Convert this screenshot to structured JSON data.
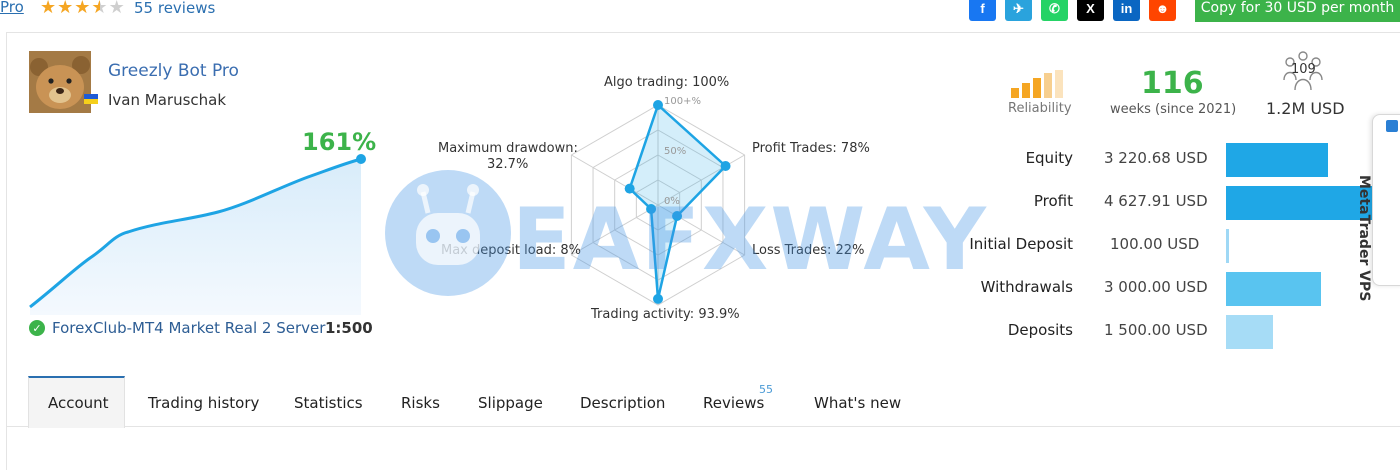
{
  "header": {
    "product_link": "Pro",
    "rating": 3.5,
    "reviews_label": "55 reviews",
    "share_icons": [
      "facebook-icon",
      "telegram-icon",
      "whatsapp-icon",
      "x-icon",
      "linkedin-icon",
      "reddit-icon"
    ],
    "share_glyphs": [
      "f",
      "✈",
      "✆",
      "X",
      "in",
      "☻"
    ],
    "share_colors": [
      "#1877f2",
      "#2aa3dd",
      "#25d366",
      "#000000",
      "#0a66c2",
      "#ff4500"
    ],
    "copy_button": "Copy for 30 USD per month"
  },
  "signal": {
    "name": "Greezly Bot Pro",
    "author": "Ivan Maruschak",
    "growth": "161%",
    "server": "ForexClub-MT4 Market Real 2 Server",
    "leverage": "1:500"
  },
  "radar": {
    "labels": {
      "algo": "Algo trading: 100%",
      "profit": "Profit Trades: 78%",
      "loss": "Loss Trades: 22%",
      "activity": "Trading activity: 93.9%",
      "deposit": "Max deposit load: 8%",
      "drawdown_title": "Maximum drawdown:",
      "drawdown_value": "32.7%"
    },
    "scale": [
      "100+%",
      "50%",
      "0%"
    ],
    "values": [
      100,
      78,
      22,
      93.9,
      8,
      32.7
    ]
  },
  "stats": {
    "reliability_label": "Reliability",
    "weeks": "116",
    "weeks_label": "weeks (since 2021)",
    "subscribers": "109",
    "funds": "1.2M USD"
  },
  "financials": [
    {
      "label": "Equity",
      "value": "3 220.68 USD",
      "fraction": 0.7,
      "color": "#1fa7e6"
    },
    {
      "label": "Profit",
      "value": "4 627.91 USD",
      "fraction": 1.0,
      "color": "#1fa7e6"
    },
    {
      "label": "Initial Deposit",
      "value": "100.00 USD",
      "fraction": 0.02,
      "color": "#9fd8f5"
    },
    {
      "label": "Withdrawals",
      "value": "3 000.00 USD",
      "fraction": 0.65,
      "color": "#59c4f0"
    },
    {
      "label": "Deposits",
      "value": "1 500.00 USD",
      "fraction": 0.32,
      "color": "#a6dcf6"
    }
  ],
  "vps": "MetaTrader VPS",
  "watermark": "EAFXWAY",
  "tabs": [
    "Account",
    "Trading history",
    "Statistics",
    "Risks",
    "Slippage",
    "Description",
    "Reviews",
    "What's new"
  ],
  "reviews_badge": "55"
}
